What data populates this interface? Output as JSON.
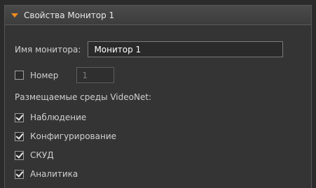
{
  "panel": {
    "title": "Свойства Монитор 1"
  },
  "form": {
    "name_label": "Имя монитора:",
    "name_value": "Монитор 1",
    "number_label": "Номер",
    "number_checked": false,
    "number_value": "1",
    "environments_label": "Размещаемые среды VideoNet:",
    "environments": [
      {
        "label": "Наблюдение",
        "checked": true
      },
      {
        "label": "Конфигурирование",
        "checked": true
      },
      {
        "label": "СКУД",
        "checked": true
      },
      {
        "label": "Аналитика",
        "checked": true
      }
    ]
  },
  "colors": {
    "accent": "#f08c1e",
    "background": "#343434"
  }
}
